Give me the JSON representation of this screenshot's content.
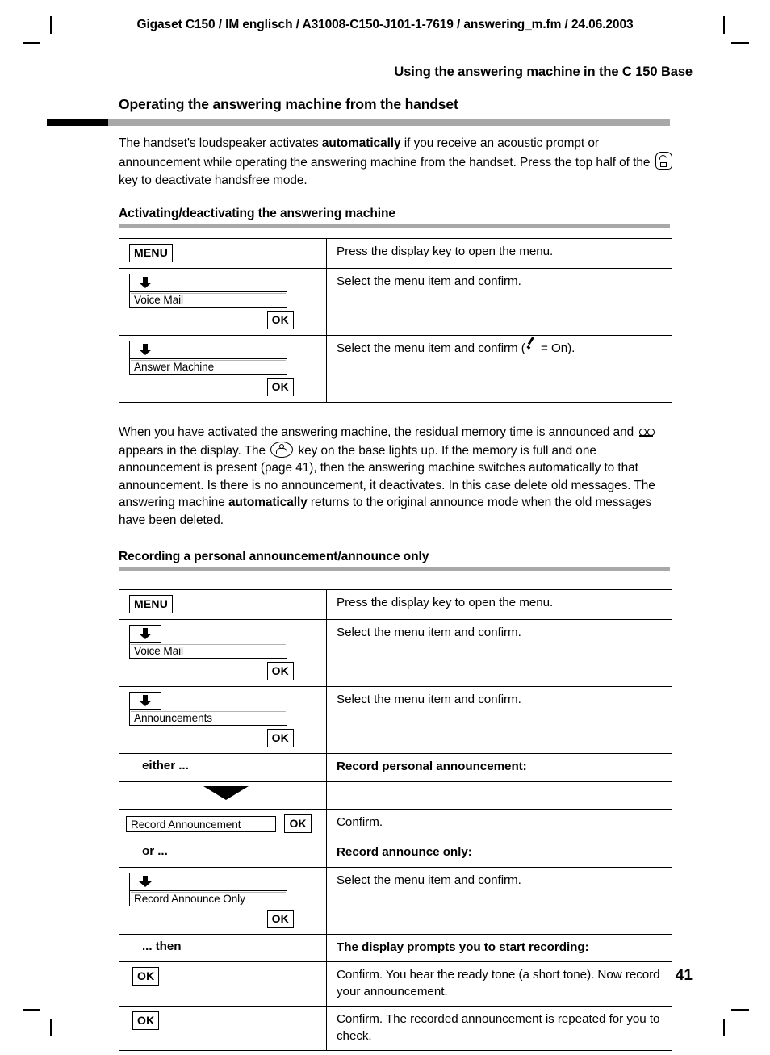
{
  "header": {
    "running_head": "Gigaset C150 / IM englisch / A31008-C150-J101-1-7619 / answering_m.fm / 24.06.2003"
  },
  "chapter_title": "Using the answering machine in the C 150 Base",
  "section": {
    "title": "Operating the answering machine from the handset",
    "intro_part1": "The handset's loudspeaker activates ",
    "intro_bold1": "automatically",
    "intro_part2": " if you receive an acoustic prompt or announcement while operating the answering machine from the handset.  Press the top half of the ",
    "intro_part3": " key to deactivate handsfree mode."
  },
  "subsection_1": {
    "title": "Activating/deactivating the answering machine",
    "rows": [
      {
        "key_type": "softkey",
        "key_label": "MENU",
        "description": "Press the display key to open the menu."
      },
      {
        "key_type": "nav-field-ok",
        "field_label": "Voice Mail",
        "ok_label": "OK",
        "description": "Select the menu item and confirm."
      },
      {
        "key_type": "nav-field-ok",
        "field_label": "Answer Machine",
        "ok_label": "OK",
        "description_part1": "Select the menu item and confirm (",
        "description_part2": " = On)."
      }
    ]
  },
  "paragraph_mid": {
    "part1": "When you have activated the answering machine, the residual memory time is announced and ",
    "part2": " appears in the display. The ",
    "part3": " key on the base lights up. If the memory is full and one announcement is present (page 41), then the answering machine switches automatically to that announcement. Is there is no announcement, it deactivates. In this case delete old messages. The answering machine ",
    "bold1": "automatically",
    "part4": " returns to the original announce mode when the old messages have been deleted."
  },
  "subsection_2": {
    "title": "Recording a personal announcement/announce only",
    "rows": [
      {
        "key_type": "softkey",
        "key_label": "MENU",
        "description": "Press the display key to open the menu."
      },
      {
        "key_type": "nav-field-ok",
        "field_label": "Voice Mail",
        "ok_label": "OK",
        "description": "Select the menu item and confirm."
      },
      {
        "key_type": "nav-field-ok",
        "field_label": "Announcements",
        "ok_label": "OK",
        "description": "Select the menu item and confirm."
      },
      {
        "key_type": "label",
        "key_label": "either ...",
        "description": "Record personal announcement:",
        "description_bold": true
      },
      {
        "key_type": "chevron",
        "key_label": "",
        "description": ""
      },
      {
        "key_type": "field-ok-inline",
        "field_label": "Record Announcement",
        "ok_label": "OK",
        "description": "Confirm."
      },
      {
        "key_type": "label",
        "key_label": "or ...",
        "description": "Record announce only:",
        "description_bold": true
      },
      {
        "key_type": "nav-field-ok",
        "field_label": "Record Announce Only",
        "ok_label": "OK",
        "description": "Select the menu item and confirm."
      },
      {
        "key_type": "label",
        "key_label": "... then",
        "description": "The display prompts you to start recording:",
        "description_bold": true
      },
      {
        "key_type": "softkey",
        "key_label": "OK",
        "description": "Confirm. You hear the ready tone (a short tone). Now record your announcement."
      },
      {
        "key_type": "softkey",
        "key_label": "OK",
        "description": "Confirm. The recorded announcement is repeated for you to check."
      }
    ]
  },
  "page_number": "41",
  "colors": {
    "rule_gray": "#a8a8a8",
    "rule_black": "#000000",
    "text": "#000000",
    "page_background": "#ffffff"
  }
}
